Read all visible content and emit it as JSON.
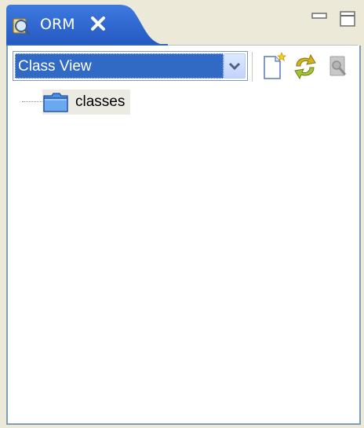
{
  "view": {
    "title": "ORM",
    "tab_icon": "orm-view-icon",
    "close_icon": "close-icon",
    "minimize_icon": "minimize-icon",
    "maximize_icon": "maximize-icon"
  },
  "toolbar": {
    "view_selector": {
      "selected": "Class View",
      "dropdown_icon": "chevron-down-icon"
    },
    "buttons": [
      {
        "name": "new-item",
        "icon": "new-file-icon",
        "enabled": true
      },
      {
        "name": "refresh",
        "icon": "refresh-icon",
        "enabled": true
      },
      {
        "name": "open-editor",
        "icon": "open-editor-icon",
        "enabled": false
      }
    ]
  },
  "tree": {
    "items": [
      {
        "label": "classes",
        "icon": "folder-icon",
        "selected": true
      }
    ]
  },
  "colors": {
    "tab_active": "#2c64c8",
    "selection": "#316ac5",
    "border": "#7f9db9",
    "background": "#ece9d8",
    "tree_highlight": "#ecebe3"
  }
}
